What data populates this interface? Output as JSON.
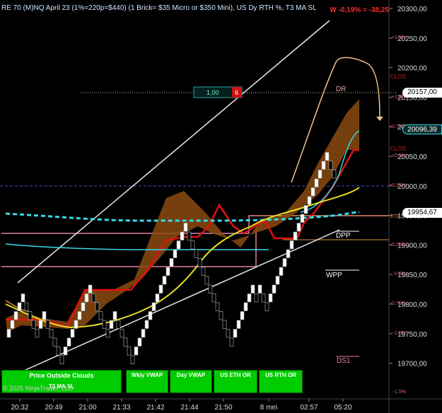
{
  "header": {
    "title": "RE 70 (M)NQ April 23 (1%=220p=$440) (1 Brick= $35 Micro or $350 Mini), US Dy RTH %, T3 MA SL",
    "pnl": "W -0,19% = -38,25"
  },
  "order_box": {
    "qty": "1,00",
    "count": "6"
  },
  "price_axis": {
    "labels": [
      "20300,00",
      "20250,00",
      "20200,00",
      "20150,00",
      "20100,00",
      "20050,00",
      "20000,00",
      "19950,00",
      "19900,00",
      "19850,00",
      "19800,00",
      "19750,00",
      "19700,00"
    ],
    "tag_last": "20157,00",
    "tag_green": "20096,39",
    "tag_white": "19954,67"
  },
  "percent_labels": [
    "+1.5%",
    "+1.0%",
    "+0.75%",
    "+0.5%",
    "+0.25%",
    "-0.25%",
    "-0.5%",
    "-0.75%",
    "-1.0%",
    "-1.5%"
  ],
  "level_labels": {
    "dr": "DR",
    "dpp": "DPP",
    "wpp": "WPP",
    "ds1": "DS1",
    "clos1": "CLOS",
    "clos2": "CLOS",
    "eth": "ETH"
  },
  "time_axis": [
    "20:32",
    "20:49",
    "21:00",
    "21:33",
    "21:42",
    "21:44",
    "21:50",
    "8 mei",
    "02:57",
    "05:20"
  ],
  "footer": {
    "clouds_label": "Price Outside Clouds",
    "t3_label": "T3 MA SL",
    "copyright": "© 2025 NinjaTrader, LLC",
    "buttons": [
      "Wkly VWAP",
      "Day VWAP",
      "US ETH OR",
      "US RTH OR"
    ]
  },
  "colors": {
    "up_brick": "#ffffff",
    "down_brick": "#000000",
    "cloud": "#8a4a10",
    "red_line": "#e41010",
    "cyan_line": "#38d8e8",
    "yellow_line": "#e8e020",
    "button_green": "#00cc00"
  }
}
